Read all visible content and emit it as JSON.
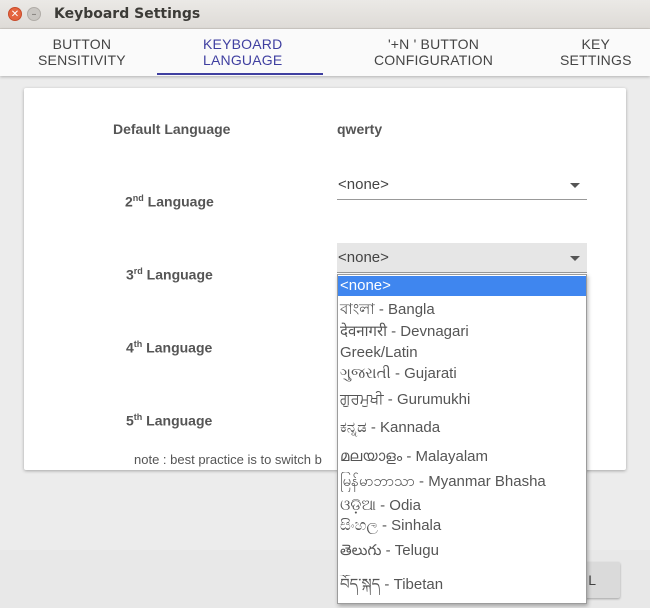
{
  "window": {
    "title": "Keyboard Settings",
    "close_glyph": "✕",
    "min_glyph": "–"
  },
  "tabs": [
    {
      "line1": "BUTTON",
      "line2": "SENSITIVITY"
    },
    {
      "line1": "KEYBOARD",
      "line2": "LANGUAGE"
    },
    {
      "line1": "'+N ' BUTTON",
      "line2": "CONFIGURATION"
    },
    {
      "line1": "KEY",
      "line2": "SETTINGS"
    }
  ],
  "form": {
    "default_label": "Default Language",
    "default_value": "qwerty",
    "lang2": {
      "num": "2",
      "sup": "nd",
      "text": " Language",
      "value": "<none>"
    },
    "lang3": {
      "num": "3",
      "sup": "rd",
      "text": " Language",
      "value": "<none>"
    },
    "lang4": {
      "num": "4",
      "sup": "th",
      "text": " Language"
    },
    "lang5": {
      "num": "5",
      "sup": "th",
      "text": " Language"
    },
    "note": "note : best practice is to switch b"
  },
  "dropdown_options": [
    "<none>",
    "বাংলা - Bangla",
    "देवनागरी - Devnagari",
    "Greek/Latin",
    "ગુજરાતી - Gujarati",
    "ਗੁਰਮੁਖੀ - Gurumukhi",
    "ಕನ್ನಡ - Kannada",
    "മലയാളം - Malayalam",
    "မြန်မာဘာသာ - Myanmar Bhasha",
    "ଓଡ଼ିଆ - Odia",
    "සිංහල - Sinhala",
    "తెలుగు - Telugu",
    "བོད་སྐད - Tibetan"
  ],
  "ok_button": "L"
}
